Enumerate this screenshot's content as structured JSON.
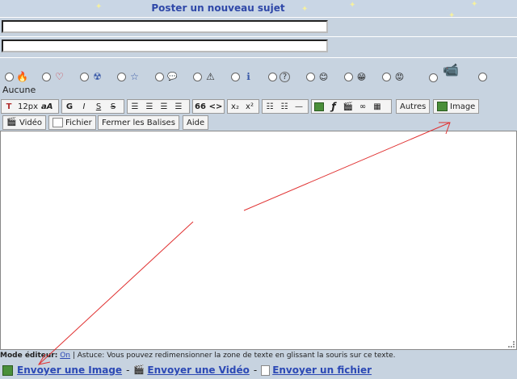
{
  "page": {
    "title": "Poster un nouveau sujet"
  },
  "form": {
    "subject_value": "",
    "description_value": ""
  },
  "icons": {
    "options": [
      {
        "name": "flame-icon",
        "glyph": "🔥"
      },
      {
        "name": "heart-icon",
        "glyph": "♡"
      },
      {
        "name": "radiation-icon",
        "glyph": "☢"
      },
      {
        "name": "star-icon",
        "glyph": "☆"
      },
      {
        "name": "speech-bubble-icon",
        "glyph": "💬"
      },
      {
        "name": "warning-icon",
        "glyph": "⚠"
      },
      {
        "name": "info-icon",
        "glyph": "ℹ"
      },
      {
        "name": "question-icon",
        "glyph": "?"
      },
      {
        "name": "smiley-icon",
        "glyph": "😊"
      },
      {
        "name": "grin-icon",
        "glyph": "😁"
      },
      {
        "name": "angry-icon",
        "glyph": "😡"
      },
      {
        "name": "camera-icon",
        "glyph": "📹"
      }
    ],
    "none_label": "Aucune"
  },
  "toolbar": {
    "font_size": "12px",
    "bold": "G",
    "italic": "I",
    "underline": "S",
    "strike": "S",
    "quote": "66",
    "code": "<>",
    "subscript": "x₂",
    "superscript": "x²",
    "others_label": "Autres",
    "image_label": "Image",
    "video_label": "Vidéo",
    "file_label": "Fichier",
    "close_tags_label": "Fermer les Balises",
    "help_label": "Aide"
  },
  "editor": {
    "content": ""
  },
  "footer": {
    "mode_label": "Mode éditeur:",
    "mode_value": "On",
    "tip": " | Astuce: Vous pouvez redimensionner la zone de texte en glissant la souris sur ce texte.",
    "send_image": "Envoyer une Image",
    "send_video": "Envoyer une Vidéo",
    "send_file": "Envoyer un fichier",
    "separator": "-"
  },
  "colors": {
    "title": "#2f48a8",
    "link": "#2c49b5",
    "annotation_arrow": "#e03030"
  }
}
